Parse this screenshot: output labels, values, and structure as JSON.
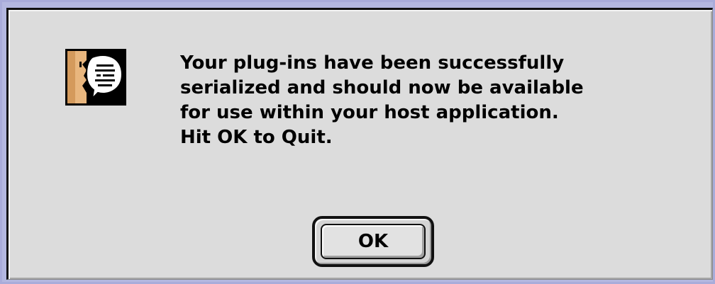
{
  "dialog": {
    "icon": "alert-note-face-speech-icon",
    "message_lines": [
      "Your plug-ins have been successfully",
      "serialized and should now be available",
      "for use within your host application.",
      "Hit OK to Quit."
    ],
    "ok_label": "OK"
  }
}
